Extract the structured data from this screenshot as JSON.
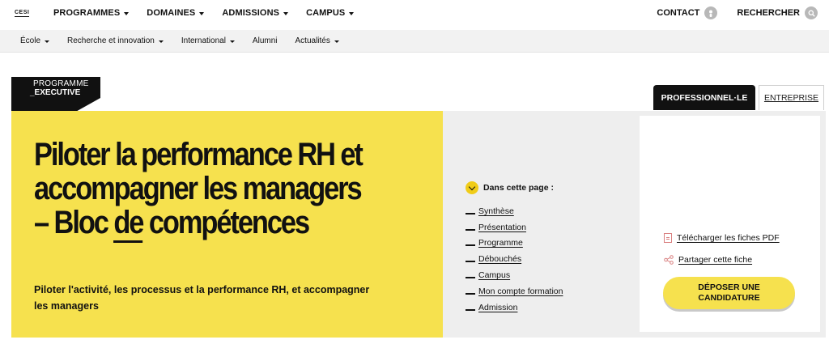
{
  "header": {
    "logo": "CESI",
    "main_nav": [
      "PROGRAMMES",
      "DOMAINES",
      "ADMISSIONS",
      "CAMPUS"
    ],
    "contact_label": "CONTACT",
    "search_label": "RECHERCHER"
  },
  "subnav": {
    "items": [
      {
        "label": "École",
        "dropdown": true
      },
      {
        "label": "Recherche et innovation",
        "dropdown": true
      },
      {
        "label": "International",
        "dropdown": true
      },
      {
        "label": "Alumni",
        "dropdown": false
      },
      {
        "label": "Actualités",
        "dropdown": true
      }
    ]
  },
  "badge": {
    "line1": "PROGRAMME",
    "line2": "_EXECUTIVE"
  },
  "hero": {
    "title_part1": "Piloter la performance RH et accompagner les managers – Bloc ",
    "title_part2": "de",
    "title_part3": " compétences",
    "subtitle": "Piloter l'activité, les processus et la performance RH, et accompagner les managers"
  },
  "toc": {
    "heading": "Dans cette page :",
    "items": [
      "Synthèse",
      "Présentation",
      "Programme",
      "Débouchés",
      "Campus",
      "Mon compte formation",
      "Admission"
    ]
  },
  "tabs": {
    "active": "PROFESSIONNEL·LE",
    "inactive": "ENTREPRISE"
  },
  "actions": {
    "download": "Télécharger les fiches PDF",
    "share": "Partager cette fiche",
    "apply_line1": "DÉPOSER UNE",
    "apply_line2": "CANDIDATURE"
  },
  "colors": {
    "accent_yellow": "#f6e14e",
    "dark": "#111111",
    "panel_gray": "#eeeeee"
  },
  "icons": {
    "contact": "user-icon",
    "search": "search-icon",
    "toc": "chevron-down-icon",
    "download": "pdf-icon",
    "share": "share-icon"
  }
}
